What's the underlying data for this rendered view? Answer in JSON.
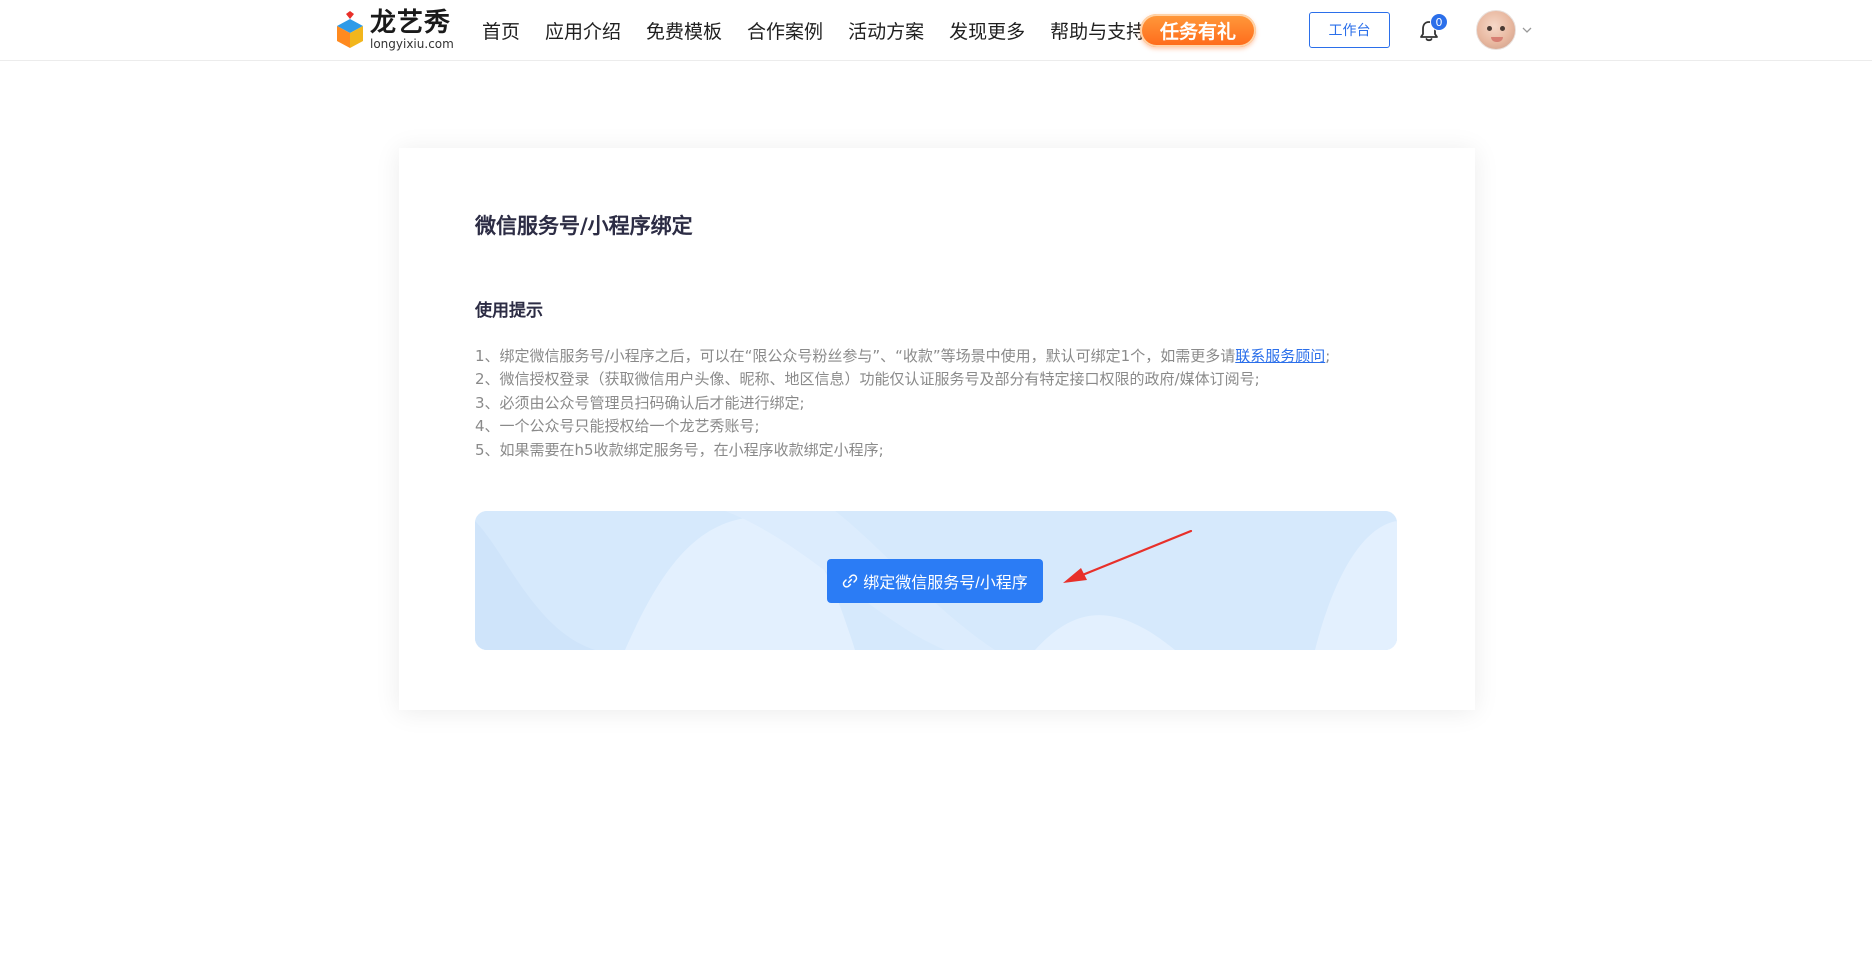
{
  "header": {
    "logo": {
      "cn": "龙艺秀",
      "en": "longyixiu.com"
    },
    "nav": [
      {
        "label": "首页"
      },
      {
        "label": "应用介绍"
      },
      {
        "label": "免费模板"
      },
      {
        "label": "合作案例"
      },
      {
        "label": "活动方案"
      },
      {
        "label": "发现更多"
      },
      {
        "label": "帮助与支持"
      }
    ],
    "task_label": "任务有礼",
    "workbench_label": "工作台",
    "notification_count": "0"
  },
  "main": {
    "title": "微信服务号/小程序绑定",
    "tips_title": "使用提示",
    "tips": {
      "t1_before": "1、绑定微信服务号/小程序之后，可以在“限公众号粉丝参与”、“收款”等场景中使用，默认可绑定1个，如需更多请",
      "t1_link": "联系服务顾问",
      "t1_after": ";",
      "t2": "2、微信授权登录（获取微信用户头像、昵称、地区信息）功能仅认证服务号及部分有特定接口权限的政府/媒体订阅号;",
      "t3": "3、必须由公众号管理员扫码确认后才能进行绑定;",
      "t4": "4、一个公众号只能授权给一个龙艺秀账号;",
      "t5": "5、如果需要在h5收款绑定服务号，在小程序收款绑定小程序;"
    },
    "bind_button_label": "绑定微信服务号/小程序"
  },
  "icons": {
    "bell": "bell-icon",
    "chevron": "chevron-down-icon",
    "link": "link-icon",
    "arrow": "red-arrow-annotation"
  },
  "colors": {
    "primary": "#2b7cf5",
    "accent_orange": "#ff7a22",
    "annotation_red": "#e8302a",
    "panel_bg": "#d9ebfd"
  }
}
